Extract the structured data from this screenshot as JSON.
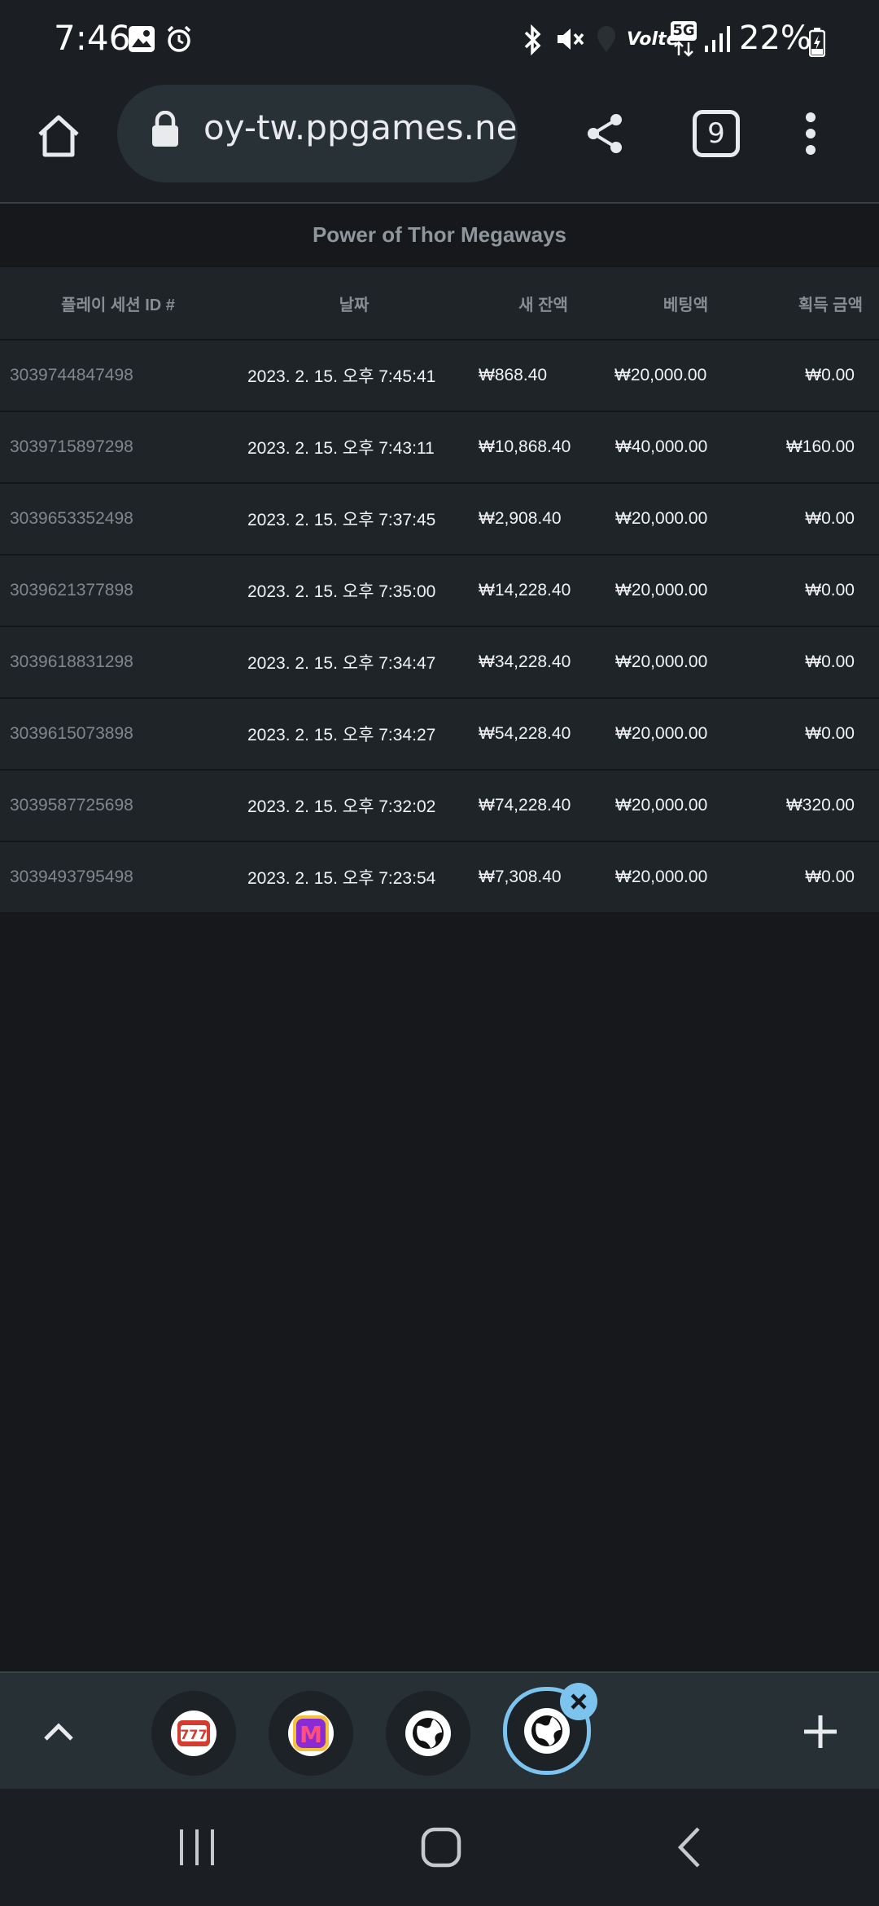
{
  "status_bar": {
    "time": "7:46",
    "battery": "22%",
    "icons": [
      "gallery-icon",
      "alarm-icon",
      "bluetooth-icon",
      "mute-icon",
      "location-icon",
      "volte-icon",
      "5g-icon",
      "signal-icon",
      "battery-charging-icon"
    ],
    "volte_label": "Volte",
    "network_label": "5G"
  },
  "toolbar": {
    "url": "oy-tw.ppgames.net",
    "tab_count": "9"
  },
  "content": {
    "game_title": "Power of Thor Megaways",
    "columns": [
      "플레이 세션 ID #",
      "날짜",
      "새 잔액",
      "베팅액",
      "획득 금액"
    ],
    "rows": [
      {
        "id": "3039744847498",
        "date": "2023. 2. 15. 오후 7:45:41",
        "balance": "₩868.40",
        "bet": "₩20,000.00",
        "win": "₩0.00"
      },
      {
        "id": "3039715897298",
        "date": "2023. 2. 15. 오후 7:43:11",
        "balance": "₩10,868.40",
        "bet": "₩40,000.00",
        "win": "₩160.00"
      },
      {
        "id": "3039653352498",
        "date": "2023. 2. 15. 오후 7:37:45",
        "balance": "₩2,908.40",
        "bet": "₩20,000.00",
        "win": "₩0.00"
      },
      {
        "id": "3039621377898",
        "date": "2023. 2. 15. 오후 7:35:00",
        "balance": "₩14,228.40",
        "bet": "₩20,000.00",
        "win": "₩0.00"
      },
      {
        "id": "3039618831298",
        "date": "2023. 2. 15. 오후 7:34:47",
        "balance": "₩34,228.40",
        "bet": "₩20,000.00",
        "win": "₩0.00"
      },
      {
        "id": "3039615073898",
        "date": "2023. 2. 15. 오후 7:34:27",
        "balance": "₩54,228.40",
        "bet": "₩20,000.00",
        "win": "₩0.00"
      },
      {
        "id": "3039587725698",
        "date": "2023. 2. 15. 오후 7:32:02",
        "balance": "₩74,228.40",
        "bet": "₩20,000.00",
        "win": "₩320.00"
      },
      {
        "id": "3039493795498",
        "date": "2023. 2. 15. 오후 7:23:54",
        "balance": "₩7,308.40",
        "bet": "₩20,000.00",
        "win": "₩0.00"
      }
    ]
  },
  "tab_strip": {
    "tabs": [
      {
        "icon": "slot-machine-icon"
      },
      {
        "icon": "m-logo-icon",
        "label": "M"
      },
      {
        "icon": "globe-icon"
      },
      {
        "icon": "globe-icon",
        "active": true
      }
    ],
    "colors": {
      "active_ring": "#7cc3ee"
    }
  },
  "colors": {
    "background": "#16181c",
    "table_row": "#1f2428",
    "muted_text": "#80878d",
    "accent": "#7cc3ee"
  }
}
